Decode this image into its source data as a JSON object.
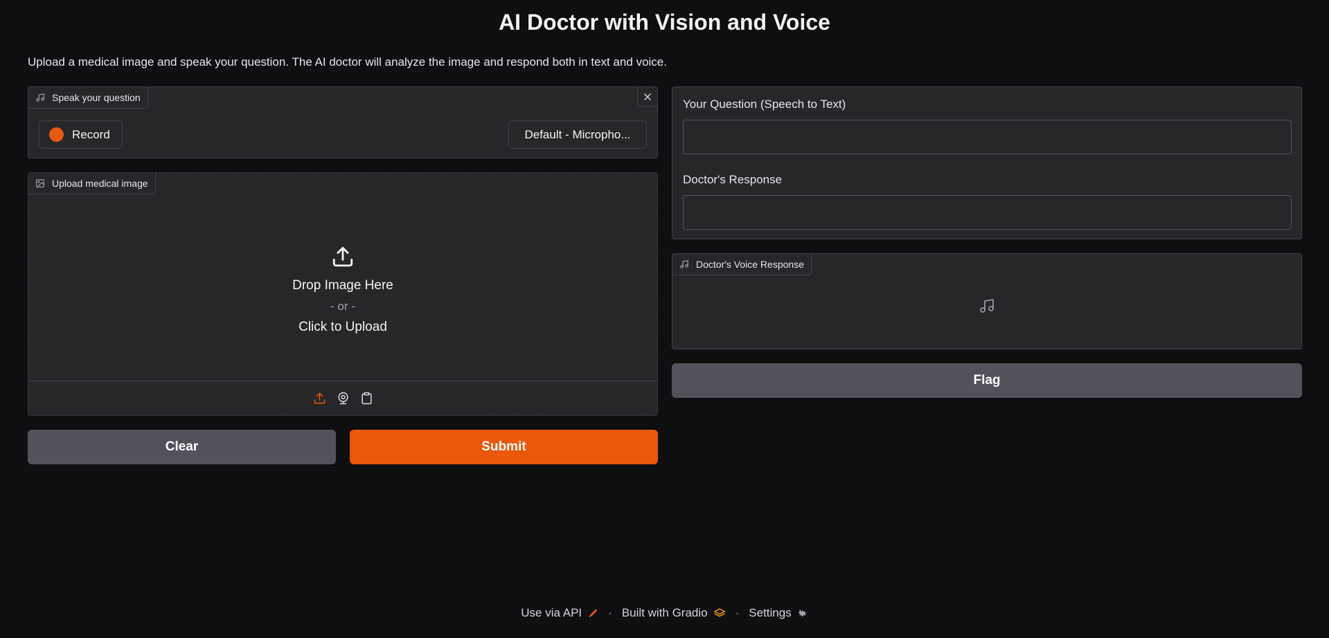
{
  "page": {
    "title": "AI Doctor with Vision and Voice",
    "description": "Upload a medical image and speak your question. The AI doctor will analyze the image and respond both in text and voice."
  },
  "audio_input": {
    "label": "Speak your question",
    "record_label": "Record",
    "device": "Default - Micropho..."
  },
  "image_input": {
    "label": "Upload medical image",
    "drop_text": "Drop Image Here",
    "or_text": "- or -",
    "click_text": "Click to Upload"
  },
  "buttons": {
    "clear": "Clear",
    "submit": "Submit",
    "flag": "Flag"
  },
  "outputs": {
    "question_label": "Your Question (Speech to Text)",
    "question_value": "",
    "response_label": "Doctor's Response",
    "response_value": "",
    "voice_label": "Doctor's Voice Response"
  },
  "footer": {
    "api": "Use via API",
    "built": "Built with Gradio",
    "settings": "Settings",
    "separator": "·"
  },
  "colors": {
    "background": "#0f0f11",
    "panel": "#27272a",
    "accent": "#ea580c",
    "secondary_button": "#52525b"
  },
  "icons": {
    "audio_label": "music-note-icon",
    "image_label": "image-icon",
    "close": "close-icon",
    "upload": "upload-icon",
    "webcam": "webcam-icon",
    "clipboard": "clipboard-icon",
    "voice_placeholder": "music-note-icon",
    "api": "rocket-icon",
    "gradio": "gradio-logo-icon",
    "settings": "gear-icon"
  }
}
